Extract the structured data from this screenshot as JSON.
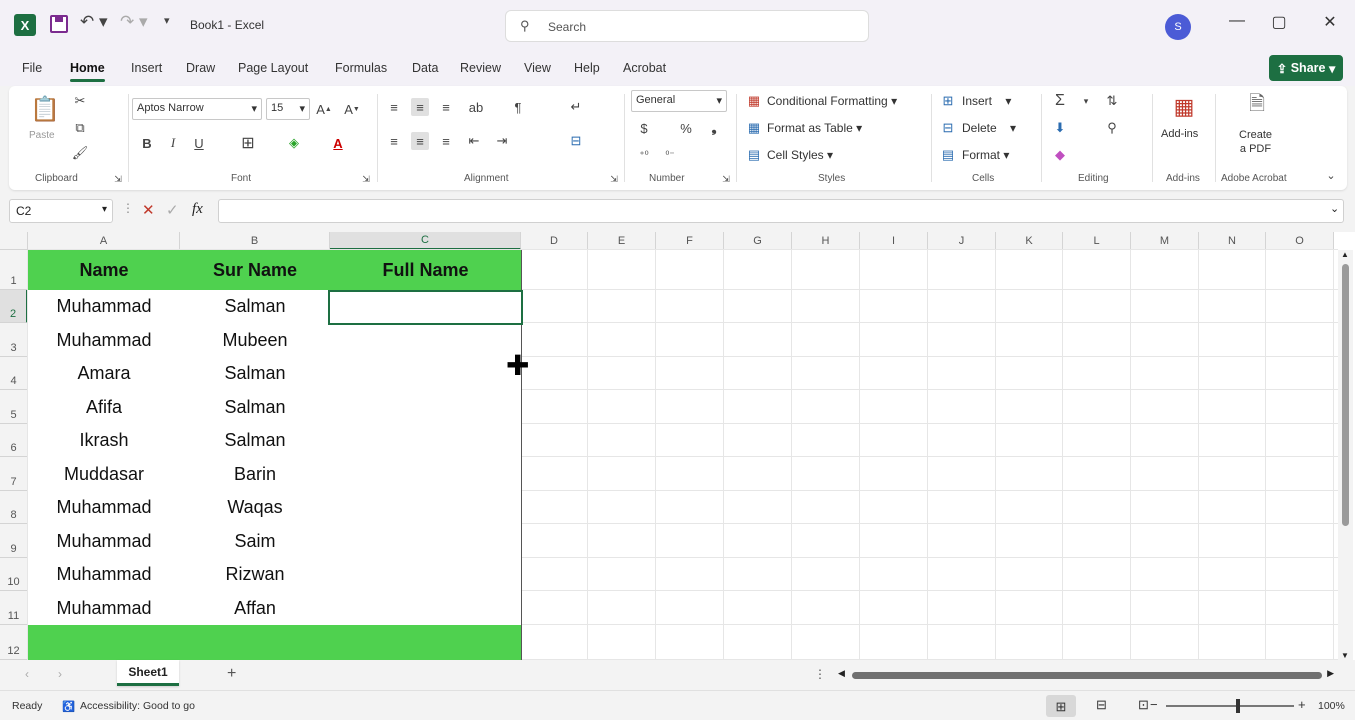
{
  "titlebar": {
    "app_logo": "X",
    "doc_title": "Book1 - Excel",
    "search_placeholder": "Search",
    "avatar_initial": "S",
    "minimize": "—",
    "restore": "▢",
    "close": "✕"
  },
  "menu": [
    "File",
    "Home",
    "Insert",
    "Draw",
    "Page Layout",
    "Formulas",
    "Data",
    "Review",
    "View",
    "Help",
    "Acrobat"
  ],
  "share_label": "Share",
  "ribbon": {
    "paste": "Paste",
    "font_name": "Aptos Narrow",
    "font_size": "15",
    "number_format": "General",
    "conditional_formatting": "Conditional Formatting",
    "format_as_table": "Format as Table",
    "cell_styles": "Cell Styles",
    "insert": "Insert",
    "delete": "Delete",
    "format": "Format",
    "addins": "Add-ins",
    "create_pdf_line1": "Create",
    "create_pdf_line2": "a PDF",
    "groups": {
      "clipboard": "Clipboard",
      "font": "Font",
      "alignment": "Alignment",
      "number": "Number",
      "styles": "Styles",
      "cells": "Cells",
      "editing": "Editing",
      "addins": "Add-ins",
      "adobe": "Adobe Acrobat"
    }
  },
  "formula_bar": {
    "name_box": "C2",
    "fx": "fx",
    "formula": ""
  },
  "grid": {
    "columns": [
      "A",
      "B",
      "C",
      "D",
      "E",
      "F",
      "G",
      "H",
      "I",
      "J",
      "K",
      "L",
      "M",
      "N",
      "O"
    ],
    "rows": [
      "1",
      "2",
      "3",
      "4",
      "5",
      "6",
      "7",
      "8",
      "9",
      "10",
      "11",
      "12"
    ],
    "header": [
      "Name",
      "Sur Name",
      "Full Name"
    ],
    "data": [
      [
        "Muhammad",
        "Salman",
        ""
      ],
      [
        "Muhammad",
        "Mubeen",
        ""
      ],
      [
        "Amara",
        "Salman",
        ""
      ],
      [
        "Afifa",
        "Salman",
        ""
      ],
      [
        "Ikrash",
        "Salman",
        ""
      ],
      [
        "Muddasar",
        "Barin",
        ""
      ],
      [
        "Muhammad",
        "Waqas",
        ""
      ],
      [
        "Muhammad",
        "Saim",
        ""
      ],
      [
        "Muhammad",
        "Rizwan",
        ""
      ],
      [
        "Muhammad",
        "Affan",
        ""
      ]
    ],
    "selected_cell": "C2"
  },
  "sheets": {
    "tabs": [
      "Sheet1"
    ],
    "add": "+"
  },
  "status": {
    "ready": "Ready",
    "accessibility": "Accessibility: Good to go",
    "zoom": "100%"
  }
}
